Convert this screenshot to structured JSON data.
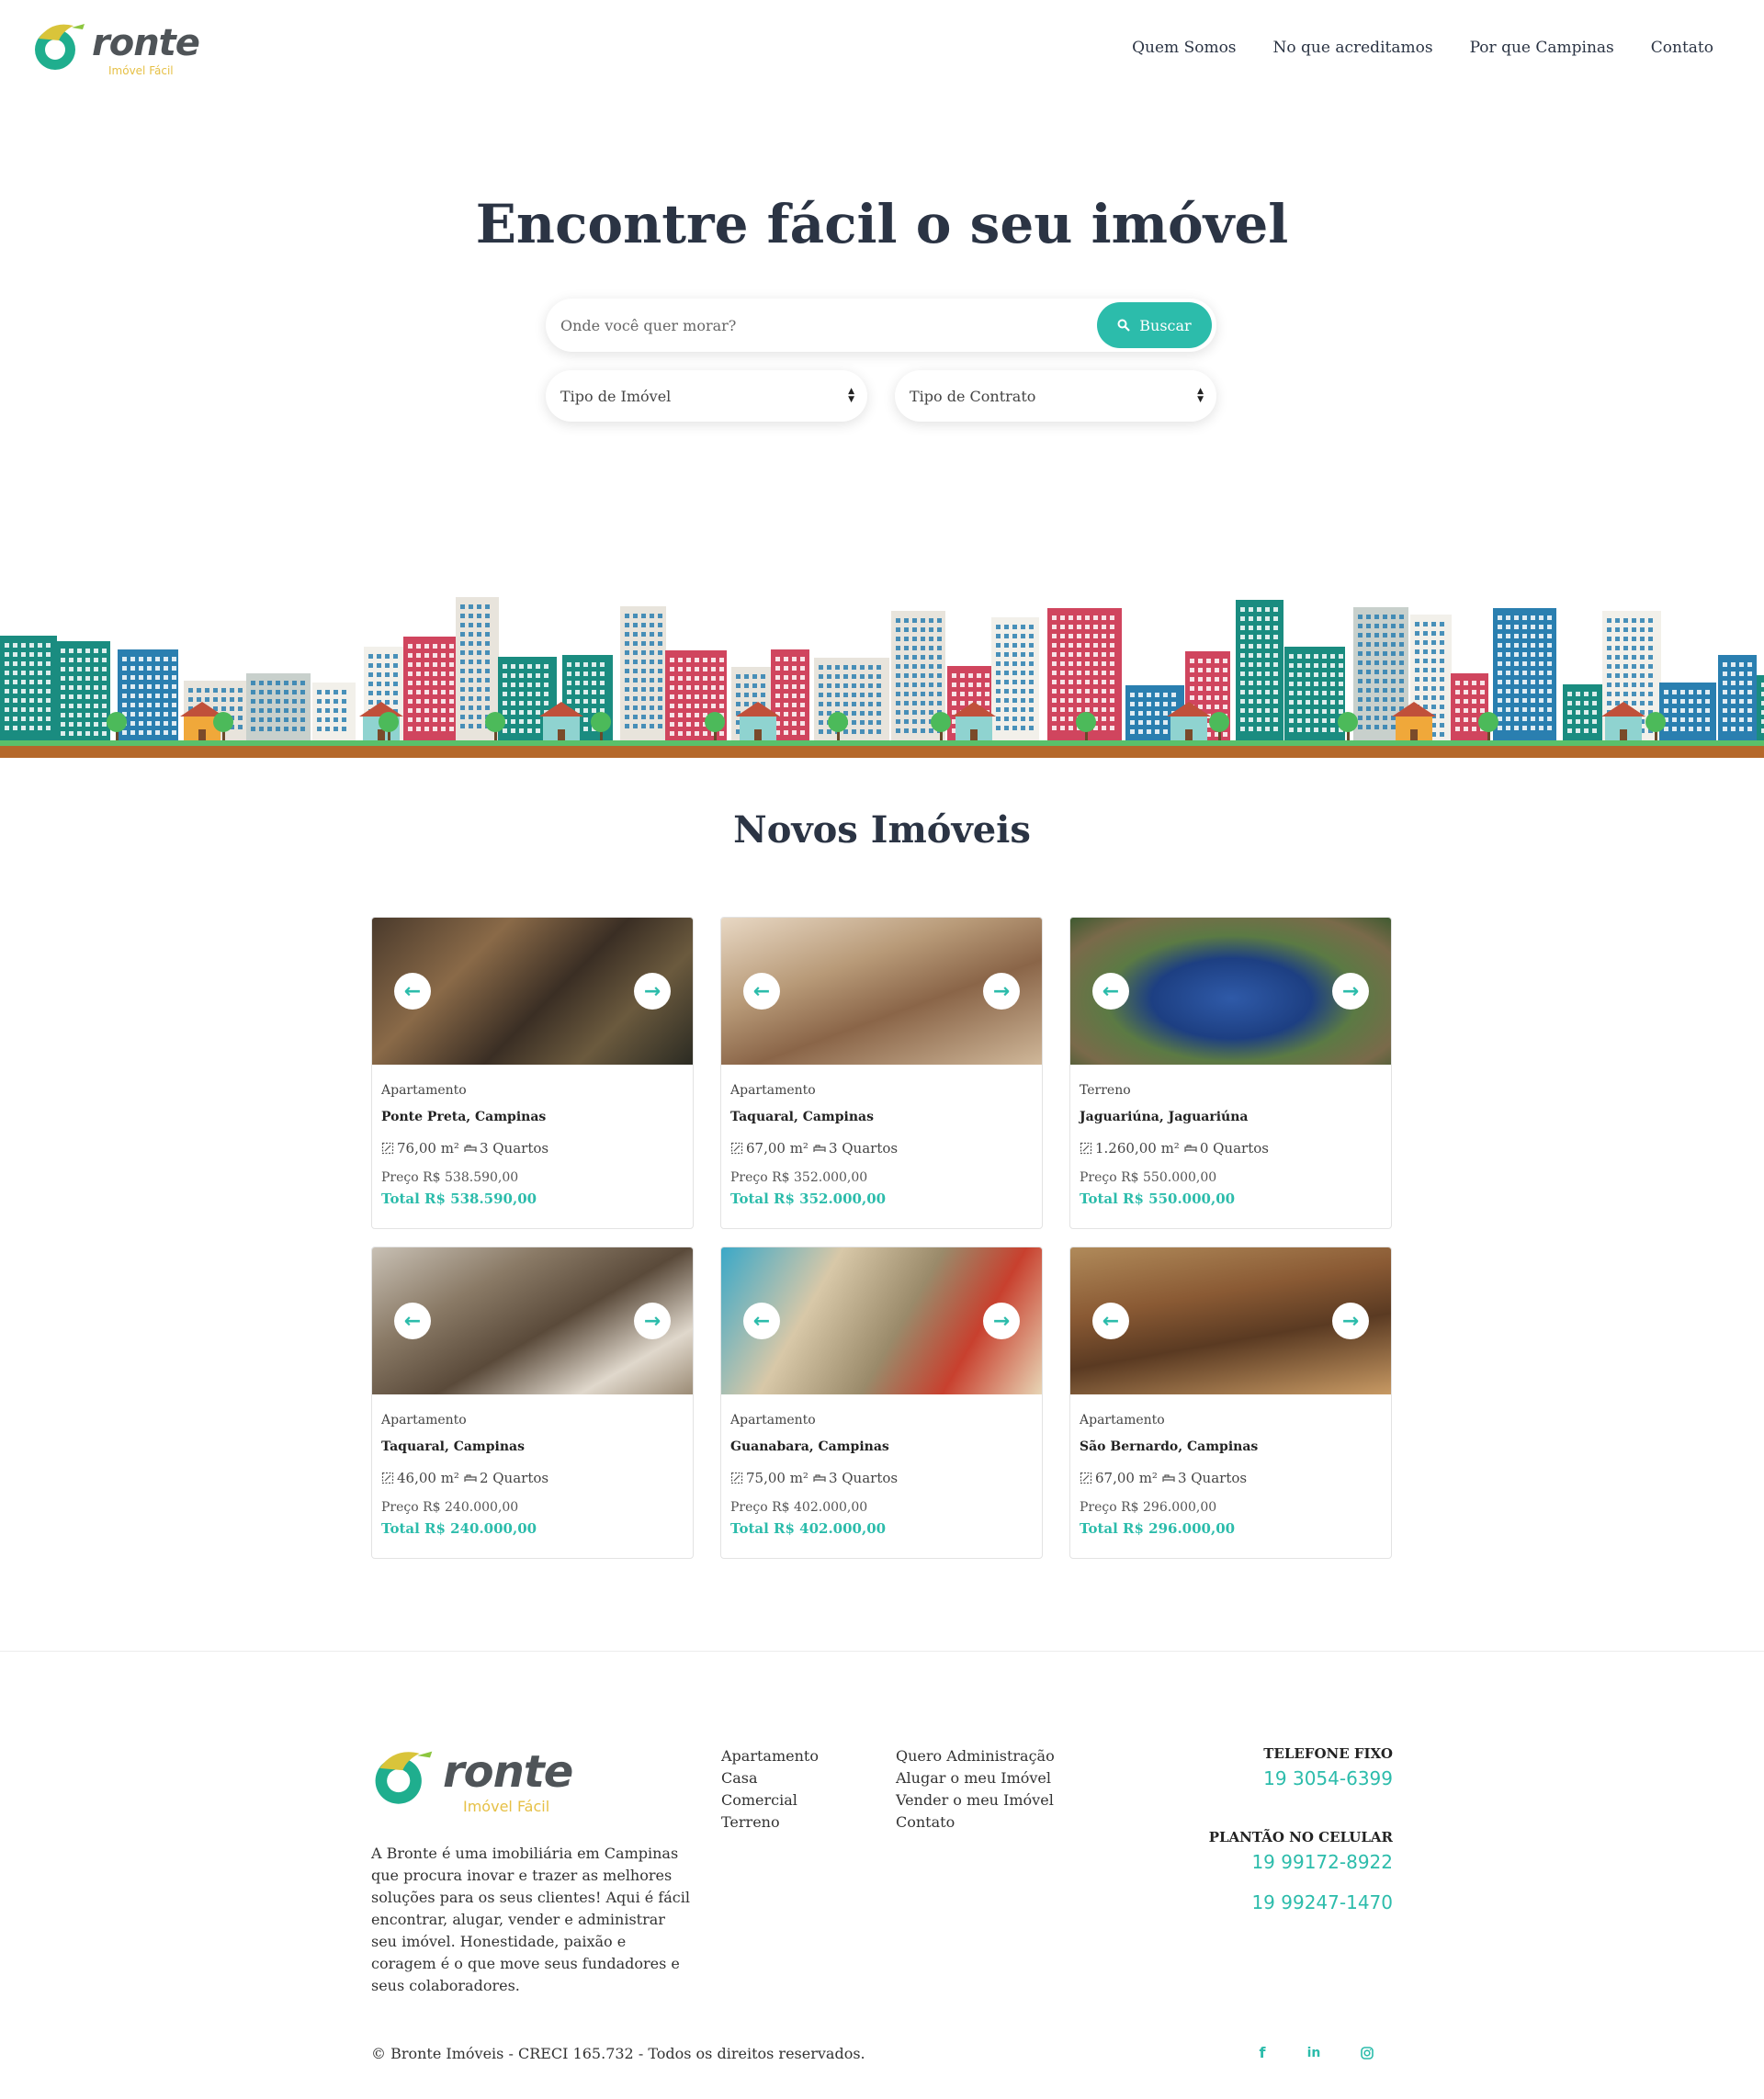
{
  "brand": {
    "name": "ronte",
    "tagline": "Imóvel Fácil"
  },
  "nav": [
    "Quem Somos",
    "No que acreditamos",
    "Por que Campinas",
    "Contato"
  ],
  "hero": {
    "title": "Encontre fácil o seu imóvel",
    "search_placeholder": "Onde você quer morar?",
    "search_button": "Buscar",
    "select_property_type": "Tipo de Imóvel",
    "select_contract_type": "Tipo de Contrato"
  },
  "listings": {
    "title": "Novos Imóveis",
    "cards": [
      {
        "type": "Apartamento",
        "location": "Ponte Preta, Campinas",
        "area": "76,00 m²",
        "rooms": "3 Quartos",
        "price": "Preço R$ 538.590,00",
        "total": "Total R$ 538.590,00",
        "image": "interior-living-dining"
      },
      {
        "type": "Apartamento",
        "location": "Taquaral, Campinas",
        "area": "67,00 m²",
        "rooms": "3 Quartos",
        "price": "Preço R$ 352.000,00",
        "total": "Total R$ 352.000,00",
        "image": "interior-kitchen-living"
      },
      {
        "type": "Terreno",
        "location": "Jaguariúna, Jaguariúna",
        "area": "1.260,00 m²",
        "rooms": "0 Quartos",
        "price": "Preço R$ 550.000,00",
        "total": "Total R$ 550.000,00",
        "image": "aerial-lake"
      },
      {
        "type": "Apartamento",
        "location": "Taquaral, Campinas",
        "area": "46,00 m²",
        "rooms": "2 Quartos",
        "price": "Preço R$ 240.000,00",
        "total": "Total R$ 240.000,00",
        "image": "interior-open-plan"
      },
      {
        "type": "Apartamento",
        "location": "Guanabara, Campinas",
        "area": "75,00 m²",
        "rooms": "3 Quartos",
        "price": "Preço R$ 402.000,00",
        "total": "Total R$ 402.000,00",
        "image": "kids-playroom"
      },
      {
        "type": "Apartamento",
        "location": "São Bernardo, Campinas",
        "area": "67,00 m²",
        "rooms": "3 Quartos",
        "price": "Preço R$ 296.000,00",
        "total": "Total R$ 296.000,00",
        "image": "outdoor-pergola"
      }
    ]
  },
  "footer": {
    "description": "A Bronte é uma imobiliária em Campinas que procura inovar e trazer as melhores soluções para os seus clientes! Aqui é fácil encontrar, alugar, vender e administrar seu imóvel. Honestidade, paixão e coragem é o que move seus fundadores e seus colaboradores.",
    "col1": [
      "Apartamento",
      "Casa",
      "Comercial",
      "Terreno"
    ],
    "col2": [
      "Quero Administração",
      "Alugar o meu Imóvel",
      "Vender o meu Imóvel",
      "Contato"
    ],
    "phone_label": "TELEFONE FIXO",
    "phone": "19 3054-6399",
    "mobile_label": "PLANTÃO NO CELULAR",
    "mobile1": "19 99172-8922",
    "mobile2": "19 99247-1470",
    "copyright": "© Bronte Imóveis - CRECI 165.732 - Todos os direitos reservados.",
    "social_icons": [
      "facebook-icon",
      "linkedin-icon",
      "instagram-icon"
    ]
  },
  "colors": {
    "accent": "#2cbcab",
    "text": "#2b3444",
    "logo_green": "#1fae8e",
    "logo_yellow": "#e6c046"
  }
}
